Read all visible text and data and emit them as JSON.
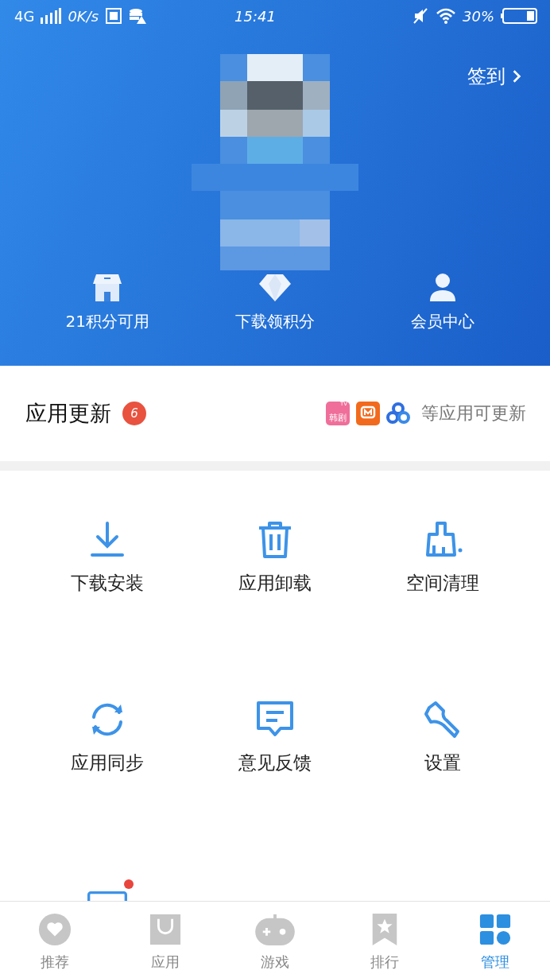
{
  "status_bar": {
    "network": "4G",
    "speed": "0K/s",
    "time": "15:41",
    "battery": "30%"
  },
  "header": {
    "sign_in": "签到",
    "stats": [
      {
        "kind": "shop",
        "label": "21积分可用"
      },
      {
        "kind": "diamond",
        "label": "下载领积分"
      },
      {
        "kind": "member",
        "label": "会员中心"
      }
    ]
  },
  "updates": {
    "title": "应用更新",
    "count": "6",
    "apps": [
      {
        "kind": "hanju",
        "label": "韩剧",
        "sup": "TV"
      },
      {
        "kind": "mango"
      },
      {
        "kind": "cloud"
      }
    ],
    "note": "等应用可更新"
  },
  "tools": [
    {
      "kind": "download",
      "label": "下载安装",
      "dot": false
    },
    {
      "kind": "trash",
      "label": "应用卸载",
      "dot": false
    },
    {
      "kind": "clean",
      "label": "空间清理",
      "dot": false
    },
    {
      "kind": "sync",
      "label": "应用同步",
      "dot": false
    },
    {
      "kind": "feedback",
      "label": "意见反馈",
      "dot": false
    },
    {
      "kind": "wrench",
      "label": "设置",
      "dot": false
    },
    {
      "kind": "card",
      "dot": true
    }
  ],
  "tabs": [
    {
      "kind": "heart",
      "label": "推荐",
      "selected": false
    },
    {
      "kind": "bag",
      "label": "应用",
      "selected": false
    },
    {
      "kind": "game",
      "label": "游戏",
      "selected": false
    },
    {
      "kind": "rank",
      "label": "排行",
      "selected": false
    },
    {
      "kind": "manage",
      "label": "管理",
      "selected": true
    }
  ]
}
